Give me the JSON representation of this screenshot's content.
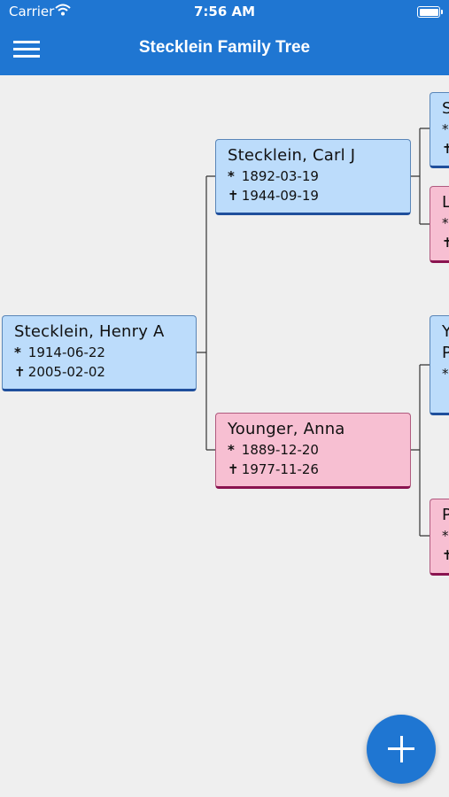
{
  "status": {
    "carrier": "Carrier",
    "time": "7:56 AM"
  },
  "header": {
    "title": "Stecklein Family Tree"
  },
  "people": [
    {
      "name": "Stecklein, Henry A",
      "birth": "1914-06-22",
      "death": "2005-02-02"
    },
    {
      "name": "Stecklein, Carl J",
      "birth": "1892-03-19",
      "death": "1944-09-19"
    },
    {
      "name": "Younger, Anna",
      "birth": "1889-12-20",
      "death": "1977-11-26"
    }
  ],
  "partial_cards": [
    {
      "lines": [
        "S",
        "*",
        "✝"
      ]
    },
    {
      "lines": [
        "L",
        "*",
        "✝"
      ]
    },
    {
      "lines": [
        "Y",
        "P",
        "*"
      ]
    },
    {
      "lines": [
        "P",
        "*",
        "✝"
      ]
    }
  ],
  "symbols": {
    "birth": "*",
    "death": "✝"
  },
  "icons": {
    "menu": "hamburger-icon",
    "add": "plus-icon",
    "wifi": "wifi-icon",
    "battery": "battery-icon"
  },
  "colors": {
    "primary": "#1f76d2",
    "male_card": "#bcdcfb",
    "female_card": "#f7bfd2"
  }
}
